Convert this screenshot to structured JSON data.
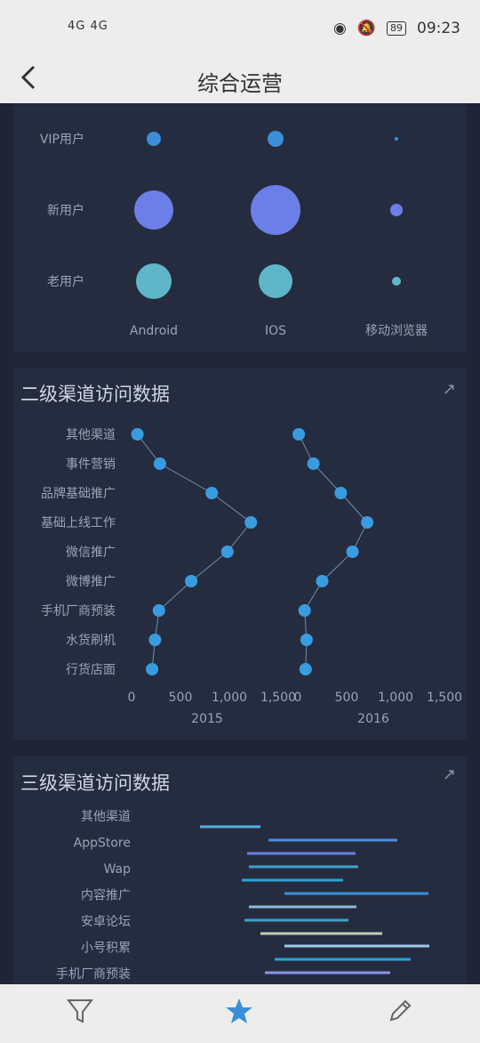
{
  "status_bar": {
    "left_icons": "4G 4G",
    "battery": "89",
    "time": "09:23"
  },
  "header": {
    "title": "综合运营"
  },
  "bubble_chart": {
    "rows": [
      "VIP用户",
      "新用户",
      "老用户"
    ],
    "columns": [
      "Android",
      "IOS",
      "移动浏览器"
    ]
  },
  "card2": {
    "title": "二级渠道访问数据"
  },
  "card3": {
    "title": "三级渠道访问数据"
  },
  "chart_data": [
    {
      "type": "scatter",
      "rows": [
        "VIP用户",
        "新用户",
        "老用户"
      ],
      "columns": [
        "Android",
        "IOS",
        "移动浏览器"
      ],
      "values": [
        [
          8,
          9,
          2
        ],
        [
          22,
          28,
          7
        ],
        [
          20,
          19,
          5
        ]
      ]
    },
    {
      "type": "line",
      "categories": [
        "其他渠道",
        "事件营销",
        "品牌基础推广",
        "基础上线工作",
        "微信推广",
        "微博推广",
        "手机厂商预装",
        "水货刷机",
        "行货店面"
      ],
      "series": [
        {
          "name": "2015",
          "values": [
            60,
            290,
            820,
            1220,
            980,
            610,
            280,
            240,
            210
          ]
        },
        {
          "name": "2016",
          "values": [
            10,
            160,
            440,
            710,
            560,
            250,
            70,
            90,
            80
          ]
        }
      ],
      "xticks": [
        "0",
        "500",
        "1,000",
        "1,500"
      ],
      "xlim": [
        0,
        1500
      ]
    },
    {
      "type": "bar",
      "categories": [
        "其他渠道",
        "AppStore",
        "Wap",
        "内容推广",
        "安卓论坛",
        "小号积累",
        "手机厂商预装"
      ]
    }
  ],
  "tabs": [
    {
      "name": "filter-icon"
    },
    {
      "name": "star-icon"
    },
    {
      "name": "edit-icon"
    }
  ]
}
